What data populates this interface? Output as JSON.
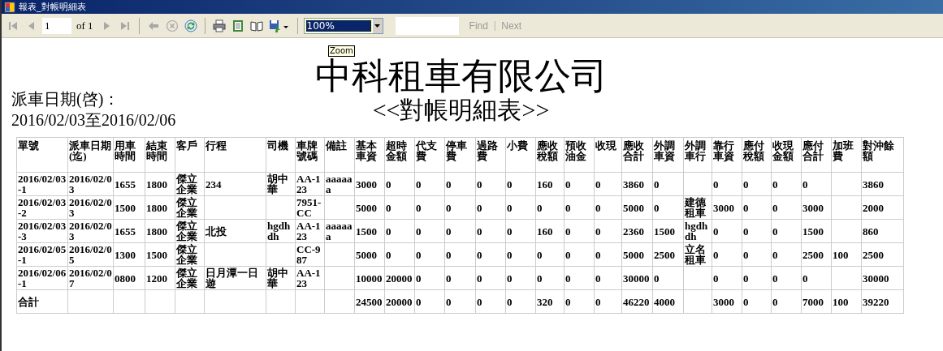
{
  "window": {
    "title": "報表_對帳明細表"
  },
  "toolbar": {
    "buttons": [
      {
        "kind": "first",
        "disabled": true
      },
      {
        "kind": "prev",
        "disabled": true
      },
      {
        "kind": "page",
        "value": "1"
      },
      {
        "kind": "label",
        "text": "of 1"
      },
      {
        "kind": "next",
        "disabled": true
      },
      {
        "kind": "last",
        "disabled": true
      },
      {
        "kind": "sep"
      },
      {
        "kind": "back",
        "disabled": true
      },
      {
        "kind": "stop",
        "disabled": true
      },
      {
        "kind": "refresh",
        "disabled": false
      },
      {
        "kind": "sep"
      },
      {
        "kind": "print",
        "disabled": false
      },
      {
        "kind": "layout",
        "disabled": false
      },
      {
        "kind": "pagesetup",
        "disabled": false
      },
      {
        "kind": "export",
        "disabled": false
      },
      {
        "kind": "sep"
      },
      {
        "kind": "zoom",
        "value": "100%"
      },
      {
        "kind": "find"
      },
      {
        "kind": "findlink",
        "text": "Find",
        "disabled": true
      },
      {
        "kind": "pipe",
        "text": "|"
      },
      {
        "kind": "findlink",
        "text": "Next",
        "disabled": true
      }
    ]
  },
  "report": {
    "company": "中科租車有限公司",
    "title": "<<對帳明細表>>",
    "date_label": "派車日期(啓)：",
    "date_range": "2016/02/03至2016/02/06",
    "tooltip": "Zoom",
    "table": {
      "columns": [
        "單號",
        "派車日期(迄)",
        "用車時間",
        "結束時間",
        "客戶",
        "行程",
        "司機",
        "車牌號碼",
        "備註",
        "基本車資",
        "超時金額",
        "代支費",
        "停車費",
        "過路費",
        "小費",
        "應收稅額",
        "預收油金",
        "收現",
        "應收合計",
        "外調車資",
        "外調車行",
        "靠行車資",
        "應付稅額",
        "收現金額",
        "應付合計",
        "加班費",
        "對沖餘額"
      ],
      "rows": [
        [
          "2016/02/03-1",
          "2016/02/03",
          "1655",
          "1800",
          "傑立企業",
          "234",
          "胡中華",
          "AA-123",
          "aaaaaa",
          "3000",
          "0",
          "0",
          "0",
          "0",
          "0",
          "160",
          "0",
          "0",
          "3860",
          "0",
          null,
          "0",
          "0",
          "0",
          "0",
          null,
          "3860"
        ],
        [
          "2016/02/03-2",
          "2016/02/03",
          "1500",
          "1800",
          "傑立企業",
          null,
          null,
          "7951-CC",
          null,
          "5000",
          "0",
          "0",
          "0",
          "0",
          "0",
          "0",
          "0",
          "0",
          "5000",
          "0",
          "建德租車",
          "3000",
          "0",
          "0",
          "3000",
          null,
          "2000"
        ],
        [
          "2016/02/03-3",
          "2016/02/03",
          "1655",
          "1800",
          "傑立企業",
          "北投",
          "hgdhdh",
          "AA-123",
          "aaaaaa",
          "1500",
          "0",
          "0",
          "0",
          "0",
          "0",
          "160",
          "0",
          "0",
          "2360",
          "1500",
          "hgdhdh",
          "0",
          "0",
          "0",
          "1500",
          null,
          "860"
        ],
        [
          "2016/02/05-1",
          "2016/02/05",
          "1300",
          "1500",
          "傑立企業",
          null,
          null,
          "CC-987",
          null,
          "5000",
          "0",
          "0",
          "0",
          "0",
          "0",
          "0",
          "0",
          "0",
          "5000",
          "2500",
          "立名租車",
          "0",
          "0",
          "0",
          "2500",
          "100",
          "2500"
        ],
        [
          "2016/02/06-1",
          "2016/02/07",
          "0800",
          "1200",
          "傑立企業",
          "日月潭一日遊",
          "胡中華",
          "AA-123",
          null,
          "10000",
          "20000",
          "0",
          "0",
          "0",
          "0",
          "0",
          "0",
          "0",
          "30000",
          "0",
          null,
          "0",
          "0",
          "0",
          "0",
          null,
          "30000"
        ],
        [
          "合計",
          null,
          null,
          null,
          null,
          null,
          null,
          null,
          null,
          "24500",
          "20000",
          "0",
          "0",
          "0",
          "0",
          "320",
          "0",
          "0",
          "46220",
          "4000",
          null,
          "3000",
          "0",
          "0",
          "7000",
          "100",
          "39220"
        ]
      ]
    }
  }
}
